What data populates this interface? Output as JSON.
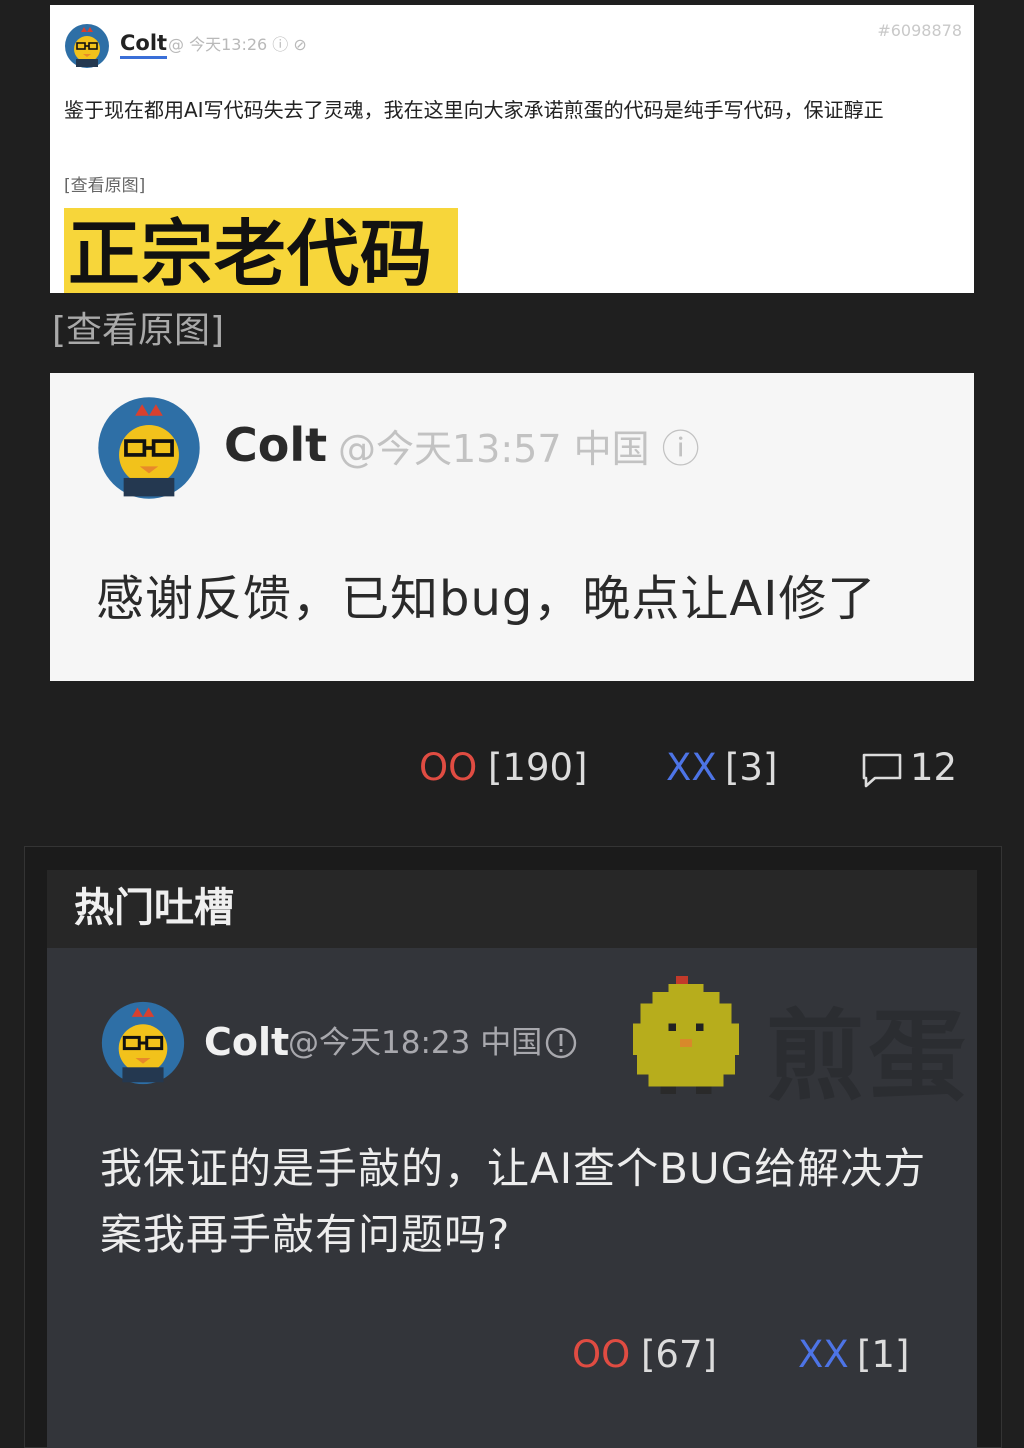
{
  "post_screenshot": {
    "author": "Colt",
    "meta": "@ 今天13:26 ⓘ ⊘",
    "post_id": "#6098878",
    "body": "鉴于现在都用AI写代码失去了灵魂，我在这里向大家承诺煎蛋的代码是纯手写代码，保证醇正",
    "view_original": "[查看原图]",
    "banner_text": "正宗老代码"
  },
  "view_original_link": "[查看原图]",
  "reply_screenshot": {
    "author": "Colt",
    "meta": "@今天13:57 中国 ⓘ",
    "body": "感谢反馈，已知bug，晚点让AI修了"
  },
  "votes": {
    "oo_label": "OO",
    "oo_count": "[190]",
    "xx_label": "XX",
    "xx_count": "[3]",
    "comment_count": "12",
    "comment_icon": "comment-bubble-icon"
  },
  "hot_comments": {
    "title": "热门吐槽",
    "items": [
      {
        "author": "Colt",
        "meta": "@今天18:23 中国",
        "info_icon": "info-icon",
        "watermark": "煎蛋",
        "text": "我保证的是手敲的，让AI查个BUG给解决方案我再手敲有问题吗?",
        "oo_label": "OO",
        "oo_count": "[67]",
        "xx_label": "XX",
        "xx_count": "[1]"
      }
    ]
  },
  "colors": {
    "oo": "#e04c42",
    "xx": "#4d74e6",
    "banner": "#f7d63a",
    "page_bg": "#1f1f1f",
    "comment_bg": "#33353a"
  }
}
